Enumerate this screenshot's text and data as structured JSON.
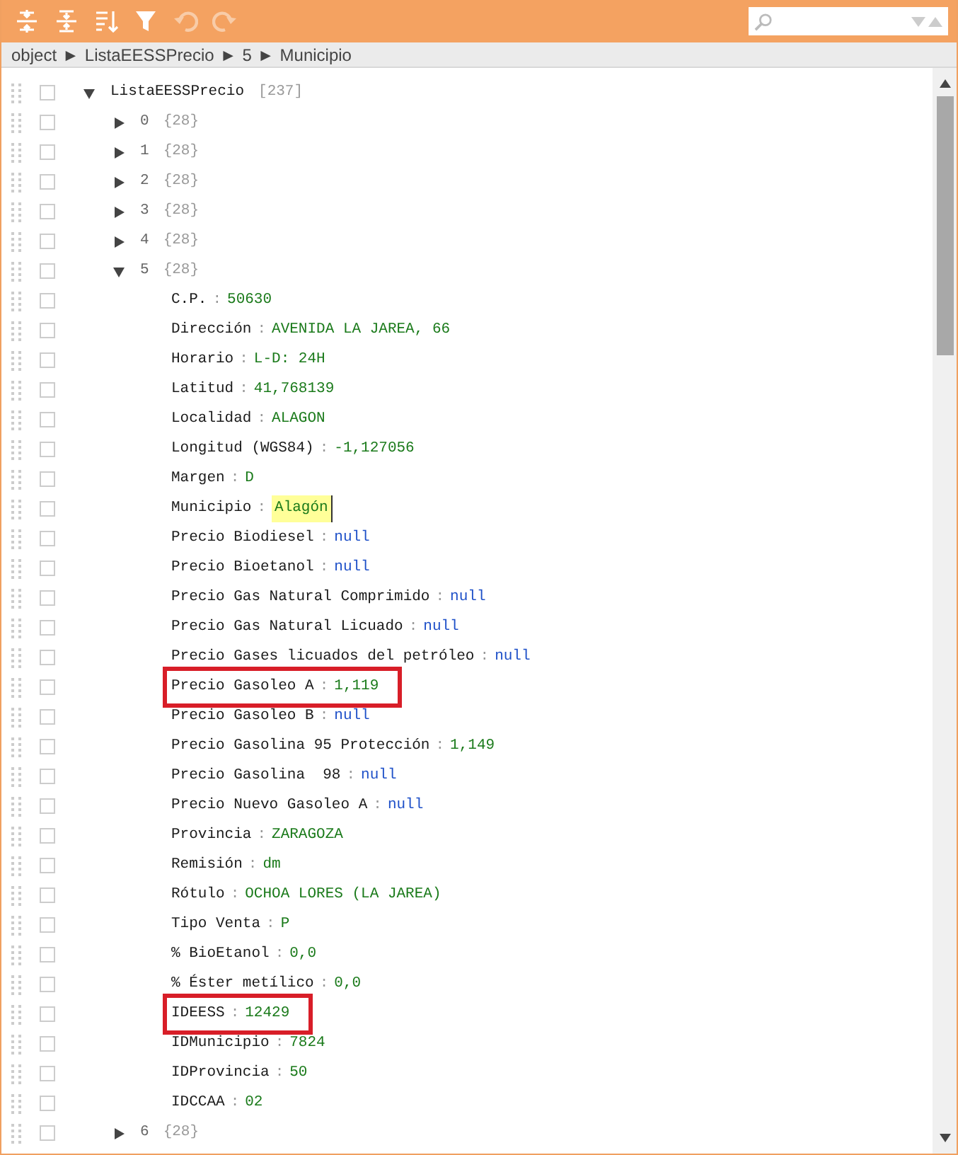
{
  "toolbar": {
    "buttons": [
      {
        "kind": "expand",
        "disabled": false
      },
      {
        "kind": "collapse",
        "disabled": false
      },
      {
        "kind": "sort",
        "disabled": false
      },
      {
        "kind": "filter",
        "disabled": false
      },
      {
        "kind": "undo",
        "disabled": true
      },
      {
        "kind": "redo",
        "disabled": true
      }
    ]
  },
  "breadcrumb": {
    "separator": "►",
    "items": [
      "object",
      "ListaEESSPrecio",
      "5",
      "Municipio"
    ]
  },
  "tree": {
    "separator": ":",
    "root": {
      "kind": "array",
      "key": "ListaEESSPrecio",
      "count": "[237]",
      "expanded": true,
      "checked": false,
      "children": [
        {
          "kind": "object",
          "key": "0",
          "count": "{28}",
          "expanded": false,
          "checked": false
        },
        {
          "kind": "object",
          "key": "1",
          "count": "{28}",
          "expanded": false,
          "checked": false
        },
        {
          "kind": "object",
          "key": "2",
          "count": "{28}",
          "expanded": false,
          "checked": false
        },
        {
          "kind": "object",
          "key": "3",
          "count": "{28}",
          "expanded": false,
          "checked": false
        },
        {
          "kind": "object",
          "key": "4",
          "count": "{28}",
          "expanded": false,
          "checked": false
        },
        {
          "kind": "object",
          "key": "5",
          "count": "{28}",
          "expanded": true,
          "checked": false,
          "children": [
            {
              "kind": "string",
              "key": "C.P.",
              "value": "50630",
              "boxed": false,
              "matched": false,
              "checked": false
            },
            {
              "kind": "string",
              "key": "Dirección",
              "value": "AVENIDA LA JAREA, 66",
              "boxed": false,
              "matched": false,
              "checked": false
            },
            {
              "kind": "string",
              "key": "Horario",
              "value": "L-D: 24H",
              "boxed": false,
              "matched": false,
              "checked": false
            },
            {
              "kind": "string",
              "key": "Latitud",
              "value": "41,768139",
              "boxed": false,
              "matched": false,
              "checked": false
            },
            {
              "kind": "string",
              "key": "Localidad",
              "value": "ALAGON",
              "boxed": false,
              "matched": false,
              "checked": false
            },
            {
              "kind": "string",
              "key": "Longitud (WGS84)",
              "value": "-1,127056",
              "boxed": false,
              "matched": false,
              "checked": false
            },
            {
              "kind": "string",
              "key": "Margen",
              "value": "D",
              "boxed": false,
              "matched": false,
              "checked": false
            },
            {
              "kind": "string",
              "key": "Municipio",
              "value": "Alagón",
              "boxed": false,
              "matched": true,
              "checked": false
            },
            {
              "kind": "null",
              "key": "Precio Biodiesel",
              "value": "null",
              "boxed": false,
              "matched": false,
              "checked": false
            },
            {
              "kind": "null",
              "key": "Precio Bioetanol",
              "value": "null",
              "boxed": false,
              "matched": false,
              "checked": false
            },
            {
              "kind": "null",
              "key": "Precio Gas Natural Comprimido",
              "value": "null",
              "boxed": false,
              "matched": false,
              "checked": false
            },
            {
              "kind": "null",
              "key": "Precio Gas Natural Licuado",
              "value": "null",
              "boxed": false,
              "matched": false,
              "checked": false
            },
            {
              "kind": "null",
              "key": "Precio Gases licuados del petróleo",
              "value": "null",
              "boxed": false,
              "matched": false,
              "checked": false
            },
            {
              "kind": "string",
              "key": "Precio Gasoleo A",
              "value": "1,119",
              "boxed": true,
              "matched": false,
              "checked": false
            },
            {
              "kind": "null",
              "key": "Precio Gasoleo B",
              "value": "null",
              "boxed": false,
              "matched": false,
              "checked": false
            },
            {
              "kind": "string",
              "key": "Precio Gasolina 95 Protección",
              "value": "1,149",
              "boxed": false,
              "matched": false,
              "checked": false
            },
            {
              "kind": "null",
              "key": "Precio Gasolina  98",
              "value": "null",
              "boxed": false,
              "matched": false,
              "checked": false
            },
            {
              "kind": "null",
              "key": "Precio Nuevo Gasoleo A",
              "value": "null",
              "boxed": false,
              "matched": false,
              "checked": false
            },
            {
              "kind": "string",
              "key": "Provincia",
              "value": "ZARAGOZA",
              "boxed": false,
              "matched": false,
              "checked": false
            },
            {
              "kind": "string",
              "key": "Remisión",
              "value": "dm",
              "boxed": false,
              "matched": false,
              "checked": false
            },
            {
              "kind": "string",
              "key": "Rótulo",
              "value": "OCHOA LORES (LA JAREA)",
              "boxed": false,
              "matched": false,
              "checked": false
            },
            {
              "kind": "string",
              "key": "Tipo Venta",
              "value": "P",
              "boxed": false,
              "matched": false,
              "checked": false
            },
            {
              "kind": "string",
              "key": "% BioEtanol",
              "value": "0,0",
              "boxed": false,
              "matched": false,
              "checked": false
            },
            {
              "kind": "string",
              "key": "% Éster metílico",
              "value": "0,0",
              "boxed": false,
              "matched": false,
              "checked": false
            },
            {
              "kind": "string",
              "key": "IDEESS",
              "value": "12429",
              "boxed": true,
              "matched": false,
              "checked": false
            },
            {
              "kind": "string",
              "key": "IDMunicipio",
              "value": "7824",
              "boxed": false,
              "matched": false,
              "checked": false
            },
            {
              "kind": "string",
              "key": "IDProvincia",
              "value": "50",
              "boxed": false,
              "matched": false,
              "checked": false
            },
            {
              "kind": "string",
              "key": "IDCCAA",
              "value": "02",
              "boxed": false,
              "matched": false,
              "checked": false
            }
          ]
        },
        {
          "kind": "object",
          "key": "6",
          "count": "{28}",
          "expanded": false,
          "checked": false
        }
      ]
    }
  }
}
